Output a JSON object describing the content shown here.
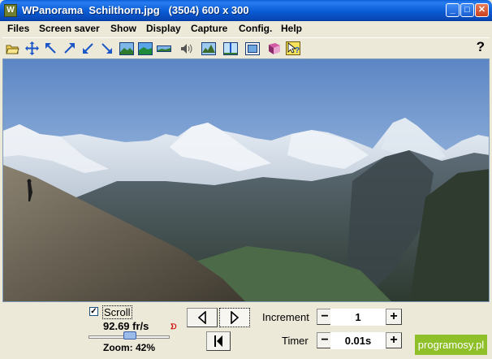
{
  "window": {
    "app_icon": "panorama-app-icon",
    "title": "WPanorama  Schilthorn.jpg   (3504) 600 x 300",
    "minimize_icon": "minimize-icon",
    "maximize_icon": "maximize-icon",
    "close_icon": "close-icon"
  },
  "menu": {
    "items": [
      "Files",
      "Screen saver",
      "Show",
      "Display",
      "Capture",
      "Config.",
      "Help"
    ]
  },
  "toolbar": {
    "icons": [
      "open-folder-icon",
      "fit-arrows-icon",
      "move-left-up-icon",
      "move-right-up-icon",
      "move-left-down-icon",
      "move-right-down-icon",
      "stretch-image-icon",
      "panorama-view-icon",
      "panorama-flat-icon",
      "sound-icon",
      "landscape-icon",
      "horizon-icon",
      "frame-icon",
      "book-icon",
      "help-cursor-icon"
    ],
    "help_label": "?"
  },
  "controls": {
    "scroll_checked": true,
    "scroll_label": "Scroll",
    "fps": "92.69 fr/s",
    "zoom": "Zoom: 42%",
    "zoom_fraction": 0.42,
    "increment_label": "Increment",
    "increment_value": "1",
    "timer_label": "Timer",
    "timer_value": "0.01s",
    "minus": "−",
    "plus": "+",
    "nav_icons": [
      "play-left-icon",
      "play-right-icon",
      "rewind-start-icon"
    ]
  },
  "brand": {
    "text": "programosy.pl",
    "color": "#8fc02a"
  }
}
